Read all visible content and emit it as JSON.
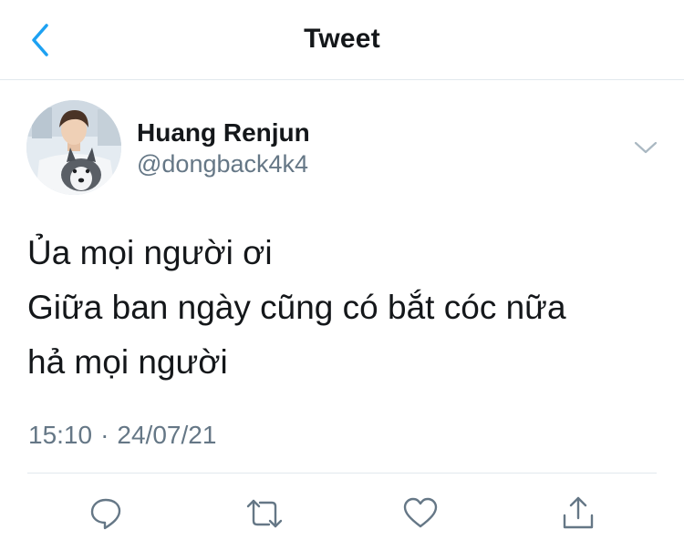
{
  "header": {
    "title": "Tweet",
    "back_icon": "chevron-left-icon"
  },
  "tweet": {
    "author": {
      "name": "Huang Renjun",
      "handle": "@dongback4k4"
    },
    "text_lines": [
      "Ủa mọi người ơi",
      "Giữa ban ngày cũng có bắt cóc nữa",
      "hả mọi người"
    ],
    "time": "15:10",
    "separator": "·",
    "date": "24/07/21"
  },
  "actions": [
    {
      "icon": "reply-icon"
    },
    {
      "icon": "retweet-icon"
    },
    {
      "icon": "heart-icon"
    },
    {
      "icon": "share-icon"
    }
  ],
  "colors": {
    "accent": "#1da1f2",
    "text": "#14171a",
    "secondary": "#657786",
    "divider": "#e1e8ed"
  }
}
